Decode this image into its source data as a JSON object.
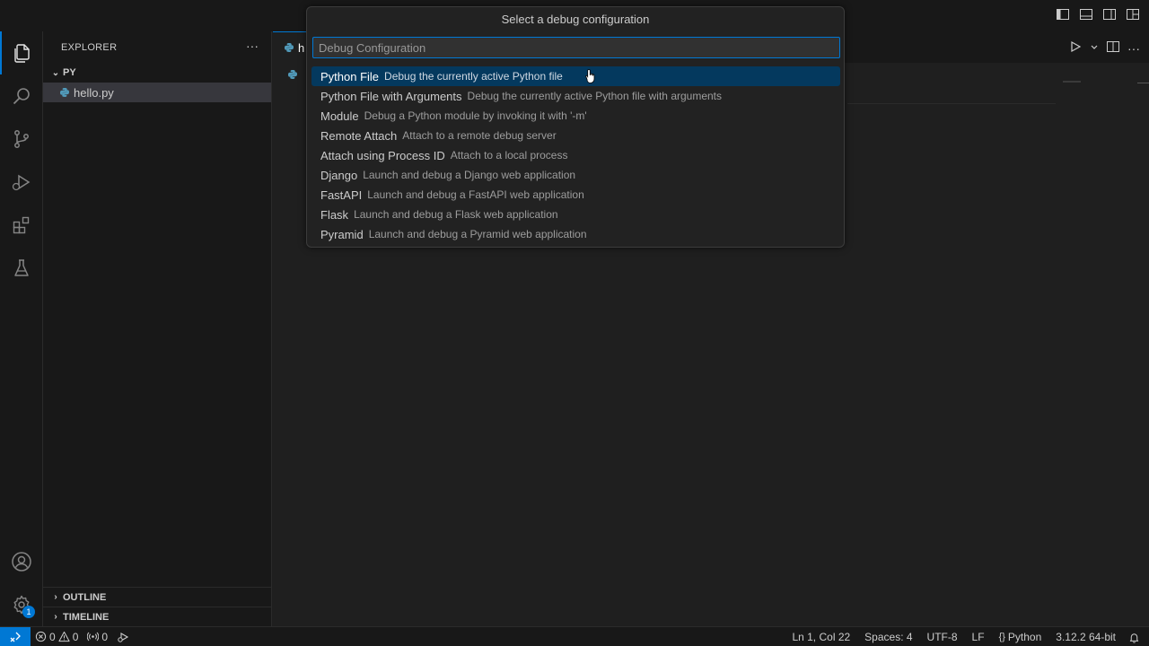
{
  "quickpick": {
    "title": "Select a debug configuration",
    "placeholder": "Debug Configuration",
    "items": [
      {
        "label": "Python File",
        "description": "Debug the currently active Python file"
      },
      {
        "label": "Python File with Arguments",
        "description": "Debug the currently active Python file with arguments"
      },
      {
        "label": "Module",
        "description": "Debug a Python module by invoking it with '-m'"
      },
      {
        "label": "Remote Attach",
        "description": "Attach to a remote debug server"
      },
      {
        "label": "Attach using Process ID",
        "description": "Attach to a local process"
      },
      {
        "label": "Django",
        "description": "Launch and debug a Django web application"
      },
      {
        "label": "FastAPI",
        "description": "Launch and debug a FastAPI web application"
      },
      {
        "label": "Flask",
        "description": "Launch and debug a Flask web application"
      },
      {
        "label": "Pyramid",
        "description": "Launch and debug a Pyramid web application"
      }
    ]
  },
  "sidebar": {
    "header": "EXPLORER",
    "folder": "PY",
    "files": [
      "hello.py"
    ],
    "outline": "OUTLINE",
    "timeline": "TIMELINE"
  },
  "editor": {
    "tab_label": "h"
  },
  "activity": {
    "settings_badge": "1"
  },
  "statusbar": {
    "errors": "0",
    "warnings": "0",
    "ports": "0",
    "position": "Ln 1, Col 22",
    "spaces": "Spaces: 4",
    "encoding": "UTF-8",
    "eol": "LF",
    "language": "Python",
    "interpreter": "3.12.2 64-bit"
  },
  "colors": {
    "accent": "#0078d4",
    "selected_item": "#04395e",
    "python_icon": "#519aba"
  },
  "icons": [
    "files-icon",
    "search-icon",
    "source-control-icon",
    "run-debug-icon",
    "extensions-icon",
    "testing-icon",
    "account-icon",
    "settings-gear-icon",
    "python-file-icon",
    "run-icon",
    "split-editor-icon",
    "more-icon",
    "remote-icon",
    "error-icon",
    "warning-icon",
    "ports-icon",
    "bell-icon",
    "braces-icon",
    "layout-icon"
  ]
}
